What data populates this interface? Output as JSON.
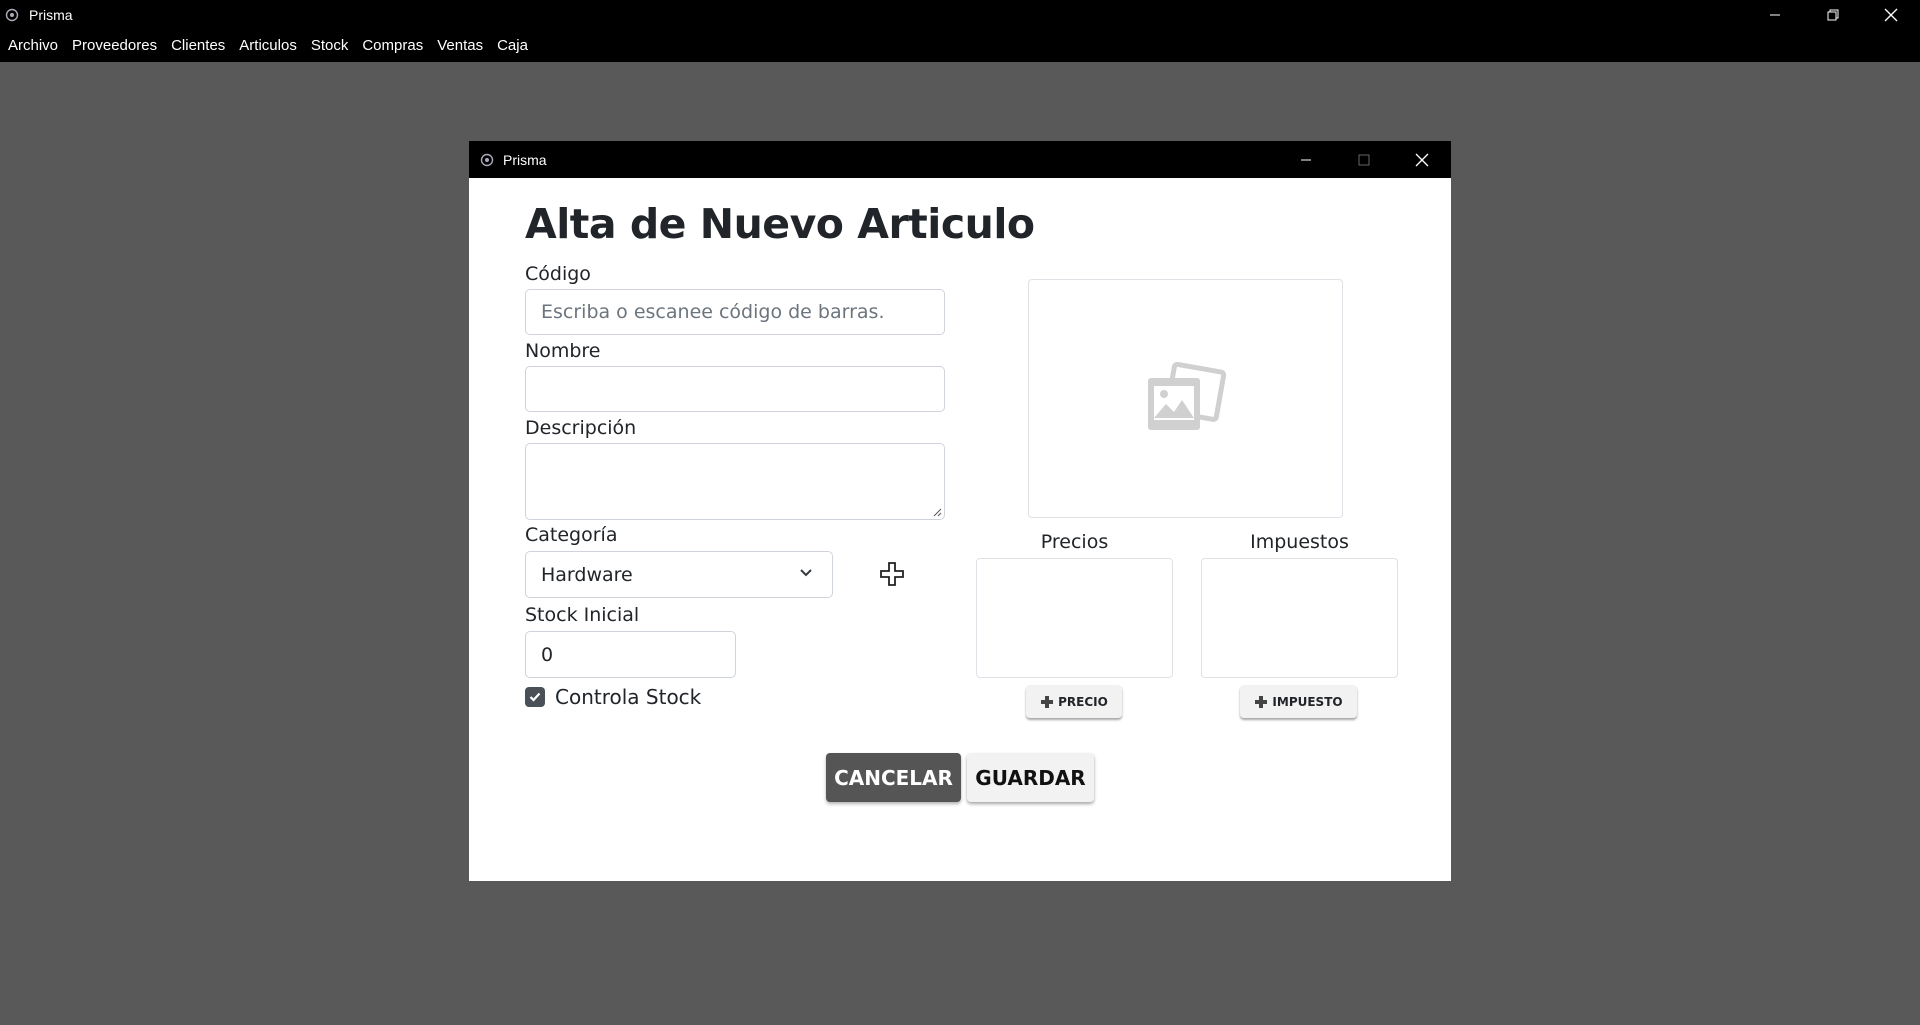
{
  "app": {
    "title": "Prisma"
  },
  "menubar": {
    "items": [
      "Archivo",
      "Proveedores",
      "Clientes",
      "Articulos",
      "Stock",
      "Compras",
      "Ventas",
      "Caja"
    ]
  },
  "dialog": {
    "title": "Prisma",
    "heading": "Alta de Nuevo Articulo",
    "codigo": {
      "label": "Código",
      "placeholder": "Escriba o escanee código de barras.",
      "value": ""
    },
    "nombre": {
      "label": "Nombre",
      "value": ""
    },
    "descripcion": {
      "label": "Descripción",
      "value": ""
    },
    "categoria": {
      "label": "Categoría",
      "selected": "Hardware"
    },
    "stock_inicial": {
      "label": "Stock Inicial",
      "value": "0"
    },
    "controla_stock": {
      "label": "Controla Stock",
      "checked": true
    },
    "precios": {
      "title": "Precios",
      "button_label": "PRECIO"
    },
    "impuestos": {
      "title": "Impuestos",
      "button_label": "IMPUESTO"
    },
    "buttons": {
      "cancel": "CANCELAR",
      "save": "GUARDAR"
    }
  },
  "icons": {
    "app": "prisma-gear-icon",
    "minimize": "minimize-icon",
    "maximize": "maximize-icon",
    "restore": "restore-icon",
    "close": "close-icon",
    "image_placeholder": "image-placeholder-icon",
    "add": "plus-icon",
    "dropdown": "chevron-down-icon",
    "check": "check-icon"
  },
  "colors": {
    "background": "#595959",
    "titlebar": "#000000",
    "cancel_button": "#555555",
    "save_button": "#f2f2f2",
    "checkbox": "#495057"
  }
}
